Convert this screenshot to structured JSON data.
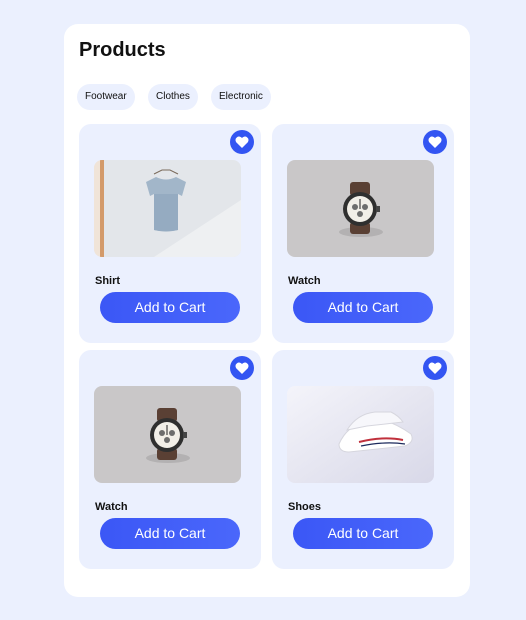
{
  "page": {
    "title": "Products"
  },
  "categories": [
    {
      "label": "Footwear"
    },
    {
      "label": "Clothes"
    },
    {
      "label": "Electronic"
    }
  ],
  "products": [
    {
      "name": "Shirt",
      "cart_label": "Add to Cart",
      "image": "t-shirt-photo",
      "favorite_icon": "heart-icon"
    },
    {
      "name": "Watch",
      "cart_label": "Add to Cart",
      "image": "watch-photo",
      "favorite_icon": "heart-icon"
    },
    {
      "name": "Watch",
      "cart_label": "Add to Cart",
      "image": "watch-photo",
      "favorite_icon": "heart-icon"
    },
    {
      "name": "Shoes",
      "cart_label": "Add to Cart",
      "image": "sneakers-photo",
      "favorite_icon": "heart-icon"
    }
  ],
  "colors": {
    "background": "#ebf0fe",
    "panel": "#ffffff",
    "accent": "#3355f2",
    "card": "#ebf0fe"
  }
}
